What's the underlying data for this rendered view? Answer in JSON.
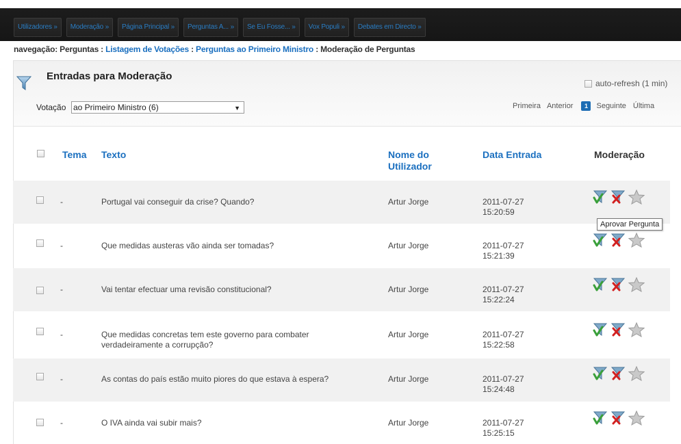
{
  "nav": {
    "tabs": [
      "Utilizadores »",
      "Moderação »",
      "Página Principal »",
      "Perguntas A... »",
      "Se Eu Fosse... »",
      "Vox Populi »",
      "Debates em Directo »"
    ]
  },
  "breadcrumb": {
    "prefix": "navegação: Perguntas : ",
    "link1": "Listagem de Votações",
    "sep1": " : ",
    "link2": "Perguntas ao Primeiro Ministro",
    "sep2": " : ",
    "current": "Moderação de Perguntas"
  },
  "panel": {
    "title": "Entradas para Moderação",
    "autorefresh_label": "auto-refresh (1 min)",
    "vote_label": "Votação",
    "vote_selected": "ao Primeiro Ministro (6)",
    "pager": {
      "first": "Primeira",
      "prev": "Anterior",
      "current": "1",
      "next": "Seguinte",
      "last": "Última"
    }
  },
  "table": {
    "headers": {
      "tema": "Tema",
      "texto": "Texto",
      "nome": "Nome do Utilizador",
      "data": "Data Entrada",
      "moderacao": "Moderação"
    },
    "rows": [
      {
        "tema": "-",
        "texto": "Portugal vai conseguir da crise? Quando?",
        "nome": "Artur Jorge",
        "date": "2011-07-27",
        "time": "15:20:59"
      },
      {
        "tema": "-",
        "texto": "Que medidas austeras vão ainda ser tomadas?",
        "nome": "Artur Jorge",
        "date": "2011-07-27",
        "time": "15:21:39"
      },
      {
        "tema": "-",
        "texto": "Vai tentar efectuar uma revisão constitucional?",
        "nome": "Artur Jorge",
        "date": "2011-07-27",
        "time": "15:22:24"
      },
      {
        "tema": "-",
        "texto": "Que medidas concretas tem este governo para combater verdadeiramente a corrupção?",
        "nome": "Artur Jorge",
        "date": "2011-07-27",
        "time": "15:22:58"
      },
      {
        "tema": "-",
        "texto": "As contas do país estão muito piores do que estava à espera?",
        "nome": "Artur Jorge",
        "date": "2011-07-27",
        "time": "15:24:48"
      },
      {
        "tema": "-",
        "texto": "O IVA ainda vai subir mais?",
        "nome": "Artur Jorge",
        "date": "2011-07-27",
        "time": "15:25:15"
      }
    ]
  },
  "tooltip": "Aprovar Pergunta",
  "icons": {
    "approve": "approve-funnel-check-icon",
    "reject": "reject-funnel-x-icon",
    "feature": "star-icon",
    "filter": "funnel-icon"
  },
  "colors": {
    "link": "#1a6fbf",
    "navbar": "#1c1c1c",
    "approve": "#3aa03a",
    "reject": "#d22020",
    "pager_current": "#1e6db4"
  }
}
